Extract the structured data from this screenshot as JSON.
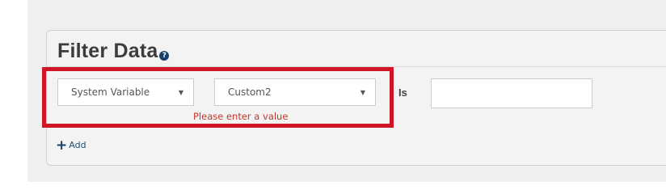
{
  "filter": {
    "title": "Filter Data",
    "help_glyph": "?",
    "variable_select": {
      "value": "System Variable",
      "caret": "▼"
    },
    "field_select": {
      "value": "Custom2",
      "caret": "▼"
    },
    "error_message": "Please enter a value",
    "operator_label": "Is",
    "value_input": {
      "value": "",
      "placeholder": ""
    },
    "add_label": "Add",
    "add_glyph": "+"
  },
  "colors": {
    "highlight": "#d01526",
    "error": "#c0392b",
    "link": "#1f4e79",
    "title": "#3c3c3c"
  }
}
